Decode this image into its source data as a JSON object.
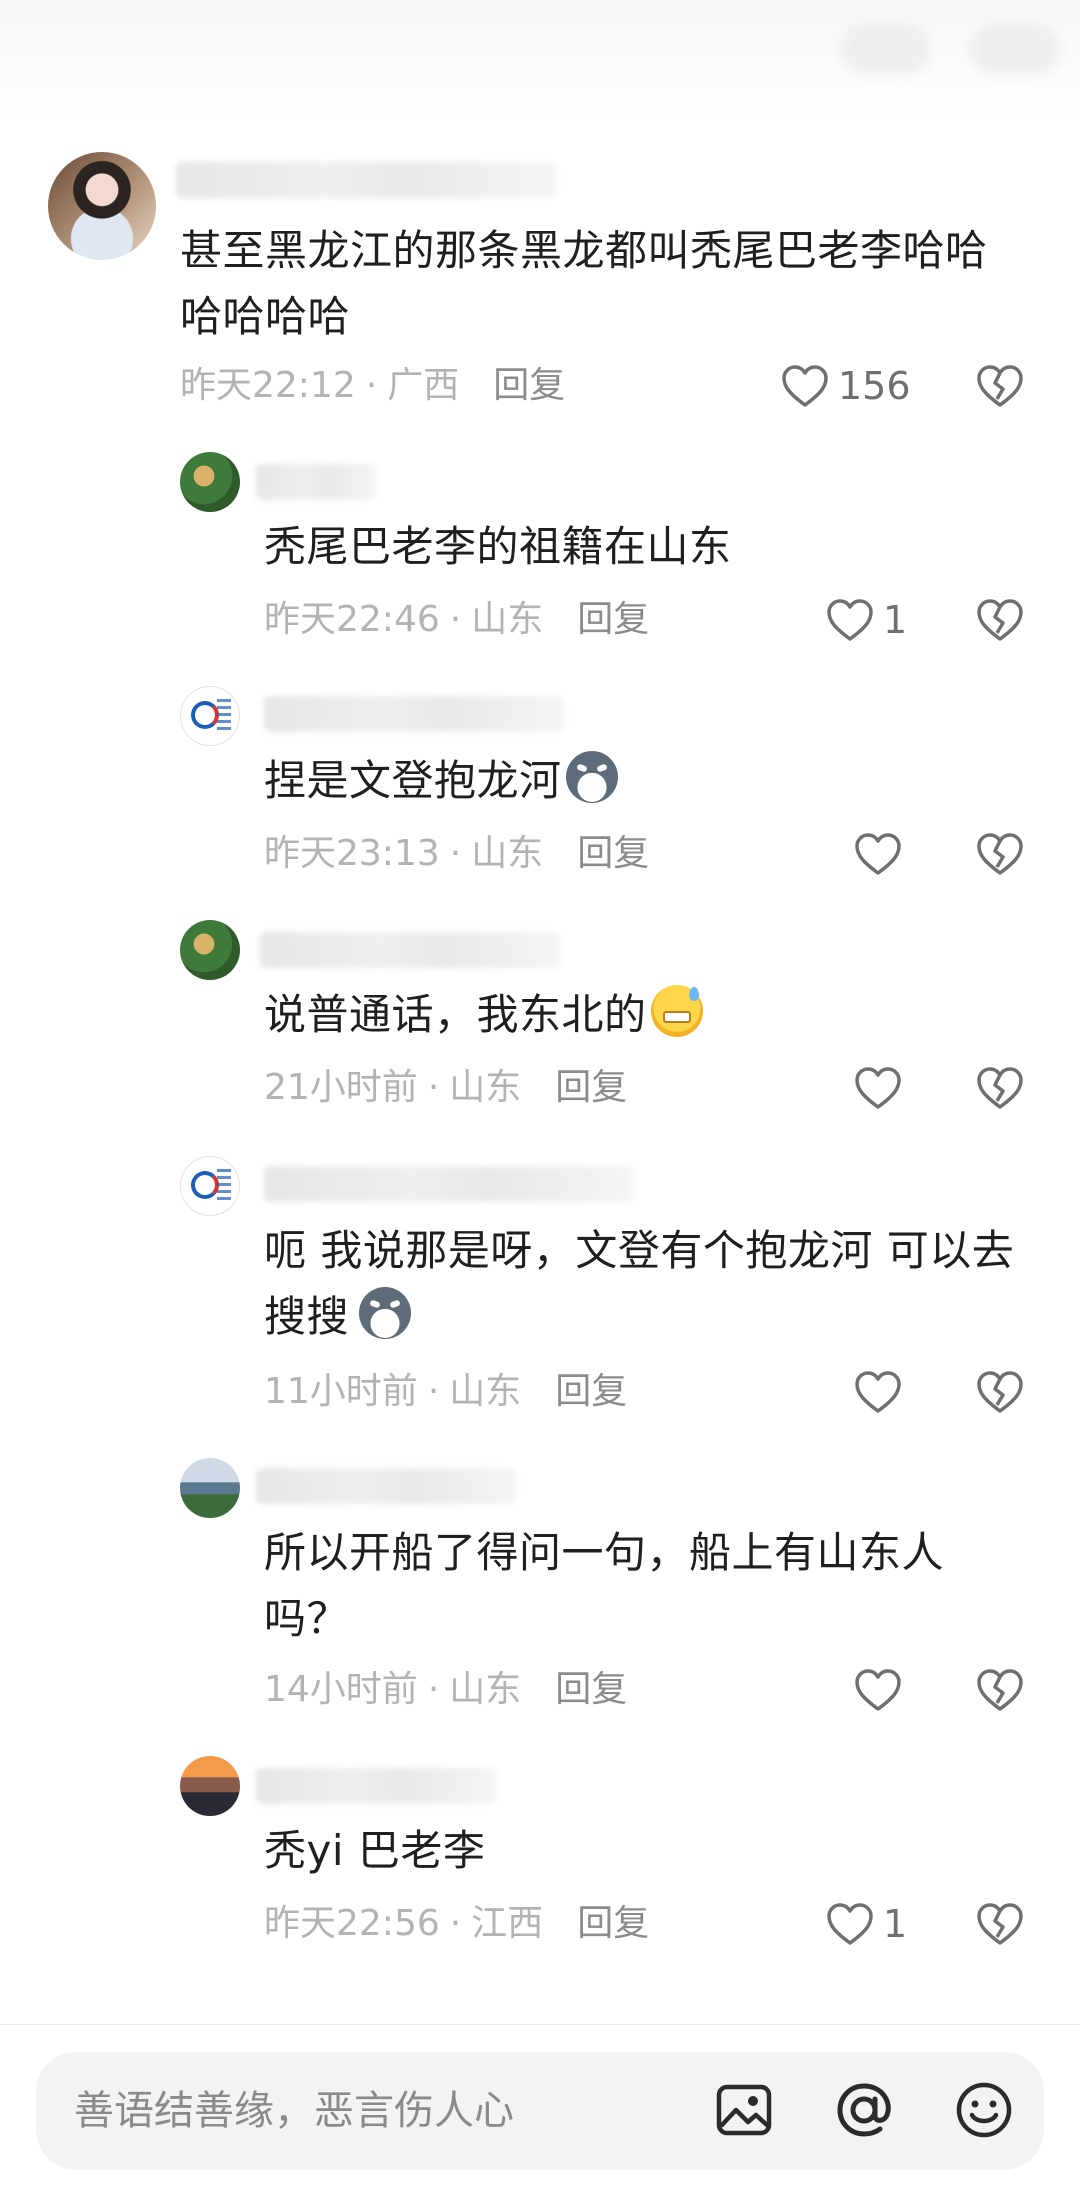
{
  "comments": [
    {
      "kind": "top",
      "text": "甚至黑龙江的那条黑龙都叫秃尾巴老李哈哈哈哈哈哈",
      "time": "昨天22:12",
      "location": "广西",
      "reply_label": "回复",
      "likes": "156"
    },
    {
      "kind": "reply",
      "text": "秃尾巴老李的祖籍在山东",
      "time": "昨天22:46",
      "location": "山东",
      "reply_label": "回复",
      "likes": "1"
    },
    {
      "kind": "reply",
      "text": "捏是文登抱龙河",
      "time": "昨天23:13",
      "location": "山东",
      "reply_label": "回复",
      "likes": ""
    },
    {
      "kind": "reply",
      "text": "说普通话，我东北的",
      "time": "21小时前",
      "location": "山东",
      "reply_label": "回复",
      "likes": ""
    },
    {
      "kind": "reply",
      "text": "呃 我说那是呀，文登有个抱龙河  可以去搜搜",
      "time": "11小时前",
      "location": "山东",
      "reply_label": "回复",
      "likes": ""
    },
    {
      "kind": "reply",
      "text": "所以开船了得问一句，船上有山东人吗？",
      "time": "14小时前",
      "location": "山东",
      "reply_label": "回复",
      "likes": ""
    },
    {
      "kind": "reply",
      "text": "秃yi 巴老李",
      "time": "昨天22:56",
      "location": "江西",
      "reply_label": "回复",
      "likes": "1"
    }
  ],
  "meta_separator": "·",
  "input": {
    "placeholder": "善语结善缘，恶言伤人心"
  },
  "icons": {
    "like": "heart-outline-icon",
    "dislike": "broken-heart-icon",
    "image": "image-icon",
    "mention": "at-icon",
    "emoji": "emoji-icon"
  }
}
